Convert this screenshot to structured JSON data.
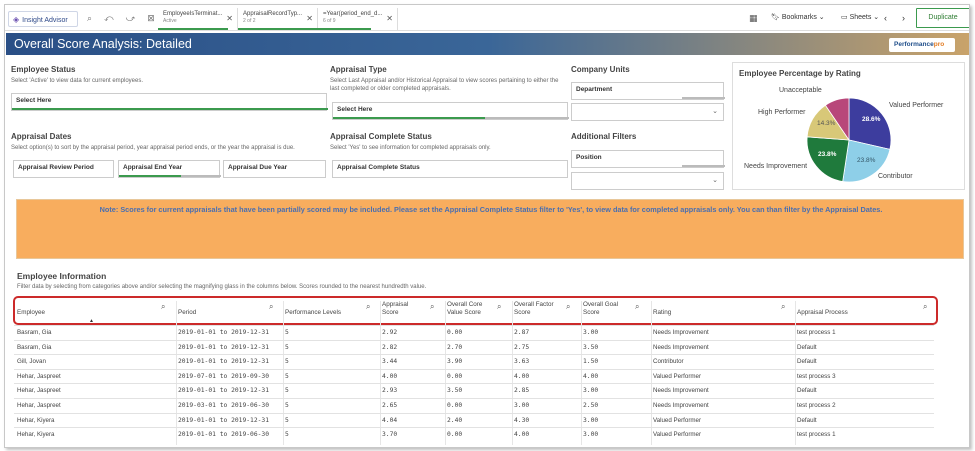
{
  "toolbar": {
    "insight_label": "Insight Advisor",
    "chips": [
      {
        "title": "EmployeeIsTerminat...",
        "sub": "Active"
      },
      {
        "title": "AppraisalRecordTyp...",
        "sub": "2 of 2"
      },
      {
        "title": "=Year(period_end_d...",
        "sub": "6 of 9"
      }
    ],
    "bookmarks": "Bookmarks",
    "sheets": "Sheets",
    "duplicate": "Duplicate"
  },
  "header": {
    "title": "Overall Score Analysis: Detailed",
    "logo_a": "Performance",
    "logo_b": "pro"
  },
  "filters": {
    "employee_status": {
      "title": "Employee Status",
      "desc": "Select 'Active' to view data for current employees.",
      "box": "Select Here"
    },
    "appraisal_type": {
      "title": "Appraisal Type",
      "desc": "Select Last Appraisal and/or Historical Appraisal to view scores pertaining to either the last completed or older completed appraisals.",
      "box": "Select Here"
    },
    "company_units": {
      "title": "Company Units",
      "box": "Department"
    },
    "appraisal_dates": {
      "title": "Appraisal Dates",
      "desc": "Select option(s) to sort by the appraisal period, year appraisal period ends, or the year the appraisal is due.",
      "b1": "Appraisal Review Period",
      "b2": "Appraisal End Year",
      "b3": "Appraisal Due Year"
    },
    "complete_status": {
      "title": "Appraisal Complete Status",
      "desc": "Select 'Yes' to see information for completed appraisals only.",
      "box": "Appraisal Complete Status"
    },
    "additional": {
      "title": "Additional Filters",
      "box": "Position"
    }
  },
  "pie": {
    "title": "Employee Percentage by Rating",
    "labels": {
      "unacceptable": "Unacceptable",
      "high": "High Performer",
      "valued": "Valued Performer",
      "needs": "Needs Improvement",
      "contributor": "Contributor"
    },
    "pct": {
      "high": "14.3%",
      "valued": "28.6%",
      "needs": "23.8%",
      "contributor": "23.8%"
    },
    "colors": {
      "valued": "#3d3d9e",
      "contributor": "#8ecfe8",
      "needs": "#1f7a3c",
      "high": "#d8c878",
      "unacceptable": "#b8477a"
    }
  },
  "note": "Note: Scores for current appraisals that have been partially scored may be included. Please set the Appraisal Complete Status filter to 'Yes', to view data for completed appraisals only. You can than filter by the Appraisal Dates.",
  "table": {
    "title": "Employee Information",
    "desc": "Filter data by selecting from categories above and/or selecting the magnifying glass in the columns below. Scores rounded to the nearest hundredth value.",
    "headers": [
      "Employee",
      "Period",
      "Performance Levels",
      "Appraisal Score",
      "Overall Core Value Score",
      "Overall Factor Score",
      "Overall Goal Score",
      "Rating",
      "Appraisal Process"
    ],
    "rows": [
      [
        "Basram, Gia",
        "2019-01-01 to 2019-12-31",
        "5",
        "2.92",
        "0.00",
        "2.87",
        "3.00",
        "Needs Improvement",
        "test process 1"
      ],
      [
        "Basram, Gia",
        "2019-01-01 to 2019-12-31",
        "5",
        "2.82",
        "2.70",
        "2.75",
        "3.50",
        "Needs Improvement",
        "Default"
      ],
      [
        "Gill, Jovan",
        "2019-01-01 to 2019-12-31",
        "5",
        "3.44",
        "3.90",
        "3.63",
        "1.50",
        "Contributor",
        "Default"
      ],
      [
        "Hehar, Jaspreet",
        "2019-07-01 to 2019-09-30",
        "5",
        "4.00",
        "0.00",
        "4.00",
        "4.00",
        "Valued Performer",
        "test process 3"
      ],
      [
        "Hehar, Jaspreet",
        "2019-01-01 to 2019-12-31",
        "5",
        "2.93",
        "3.50",
        "2.85",
        "3.00",
        "Needs Improvement",
        "Default"
      ],
      [
        "Hehar, Jaspreet",
        "2019-03-01 to 2019-06-30",
        "5",
        "2.65",
        "0.00",
        "3.00",
        "2.50",
        "Needs Improvement",
        "test process 2"
      ],
      [
        "Hehar, Kiyera",
        "2019-01-01 to 2019-12-31",
        "5",
        "4.04",
        "2.40",
        "4.30",
        "3.00",
        "Valued Performer",
        "Default"
      ],
      [
        "Hehar, Kiyera",
        "2019-01-01 to 2019-06-30",
        "5",
        "3.70",
        "0.00",
        "4.00",
        "3.00",
        "Valued Performer",
        "test process 1"
      ]
    ]
  }
}
